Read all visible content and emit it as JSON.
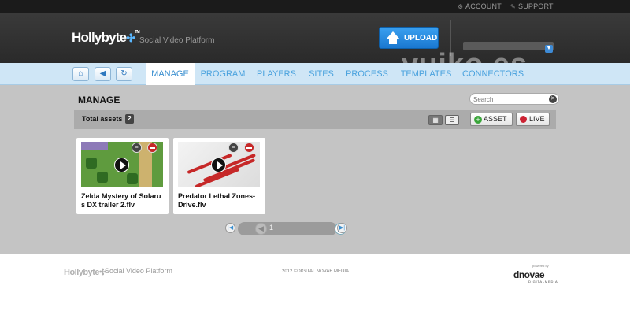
{
  "topbar": {
    "account_label": "ACCOUNT",
    "support_label": "SUPPORT"
  },
  "header": {
    "logo": "Hollybyte",
    "tagline": "Social Video Platform",
    "upload_label": "UPLOAD",
    "watermark": "vuiko.es"
  },
  "nav": {
    "tabs": [
      {
        "label": "MANAGE",
        "active": true
      },
      {
        "label": "PROGRAM"
      },
      {
        "label": "PLAYERS"
      },
      {
        "label": "SITES"
      },
      {
        "label": "PROCESS"
      },
      {
        "label": "TEMPLATES"
      },
      {
        "label": "CONNECTORS"
      }
    ]
  },
  "main": {
    "title": "MANAGE",
    "search_placeholder": "Search",
    "total_label": "Total assets",
    "total_count": "2",
    "asset_btn": "ASSET",
    "live_btn": "LIVE",
    "cards": [
      {
        "title": "Zelda Mystery of Solaru s DX trailer 2.flv"
      },
      {
        "title": "Predator Lethal Zones-Drive.flv"
      }
    ],
    "pager": {
      "page": "1"
    }
  },
  "footer": {
    "logo": "Hollybyte",
    "tagline": "Social Video Platform",
    "copyright": "2012 ©DIGITAL NOVAE MEDIA",
    "powered_by": "powered by",
    "brand": "dnovae",
    "brand_sub": "DIGITALMEDIA"
  },
  "colors": {
    "accent": "#3a8fd0",
    "nav_bg": "#cfe6f6",
    "main_bg": "#c4c4c4",
    "header_bg": "#2e2e2e"
  }
}
